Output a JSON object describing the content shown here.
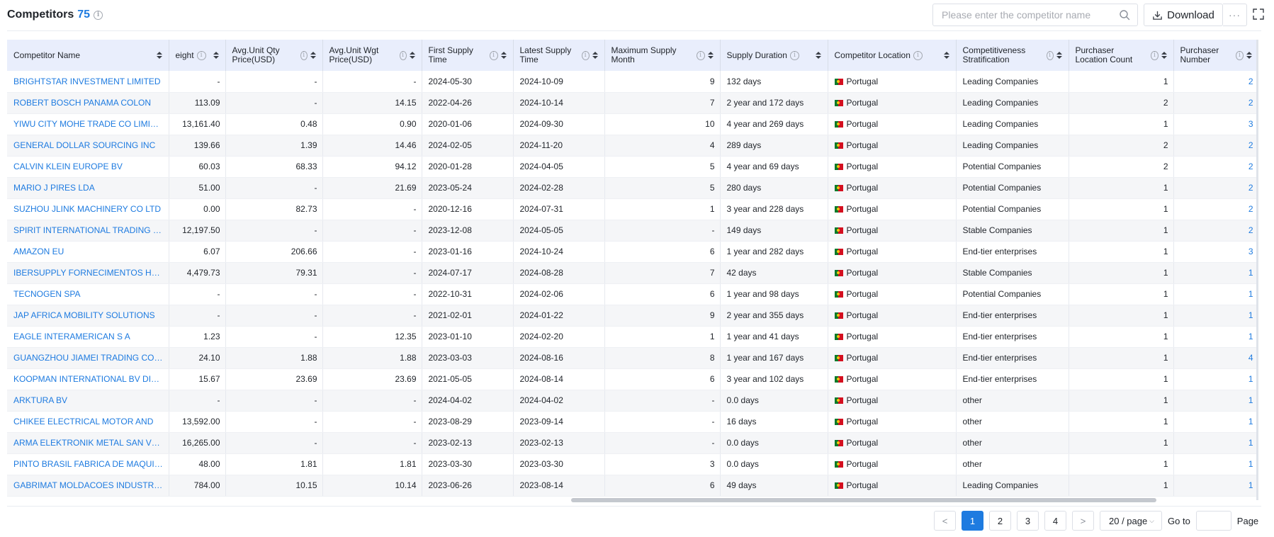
{
  "header": {
    "title": "Competitors",
    "count": "75",
    "search_placeholder": "Please enter the competitor name",
    "download_label": "Download",
    "more_label": "···"
  },
  "table": {
    "columns": [
      {
        "label": "Competitor Name",
        "info": false
      },
      {
        "label": "eight",
        "info": true
      },
      {
        "label": "Avg.Unit Qty Price(USD)",
        "info": true
      },
      {
        "label": "Avg.Unit Wgt Price(USD)",
        "info": true
      },
      {
        "label": "First Supply Time",
        "info": true
      },
      {
        "label": "Latest Supply Time",
        "info": true
      },
      {
        "label": "Maximum Supply Month",
        "info": true
      },
      {
        "label": "Supply Duration",
        "info": true
      },
      {
        "label": "Competitor Location",
        "info": true
      },
      {
        "label": "Competitiveness Stratification",
        "info": true
      },
      {
        "label": "Purchaser Location Count",
        "info": true
      },
      {
        "label": "Purchaser Number",
        "info": true
      }
    ],
    "rows": [
      [
        "BRIGHTSTAR INVESTMENT LIMITED",
        "-",
        "-",
        "-",
        "2024-05-30",
        "2024-10-09",
        "9",
        "132 days",
        "Portugal",
        "Leading Companies",
        "1",
        "2"
      ],
      [
        "ROBERT BOSCH PANAMA COLON",
        "113.09",
        "-",
        "14.15",
        "2022-04-26",
        "2024-10-14",
        "7",
        "2 year and 172 days",
        "Portugal",
        "Leading Companies",
        "2",
        "2"
      ],
      [
        "YIWU CITY MOHE TRADE CO LIMITED",
        "13,161.40",
        "0.48",
        "0.90",
        "2020-01-06",
        "2024-09-30",
        "10",
        "4 year and 269 days",
        "Portugal",
        "Leading Companies",
        "1",
        "3"
      ],
      [
        "GENERAL DOLLAR SOURCING INC",
        "139.66",
        "1.39",
        "14.46",
        "2024-02-05",
        "2024-11-20",
        "4",
        "289 days",
        "Portugal",
        "Leading Companies",
        "2",
        "2"
      ],
      [
        "CALVIN KLEIN EUROPE BV",
        "60.03",
        "68.33",
        "94.12",
        "2020-01-28",
        "2024-04-05",
        "5",
        "4 year and 69 days",
        "Portugal",
        "Potential Companies",
        "2",
        "2"
      ],
      [
        "MARIO J PIRES LDA",
        "51.00",
        "-",
        "21.69",
        "2023-05-24",
        "2024-02-28",
        "5",
        "280 days",
        "Portugal",
        "Potential Companies",
        "1",
        "2"
      ],
      [
        "SUZHOU JLINK MACHINERY CO LTD",
        "0.00",
        "82.73",
        "-",
        "2020-12-16",
        "2024-07-31",
        "1",
        "3 year and 228 days",
        "Portugal",
        "Potential Companies",
        "1",
        "2"
      ],
      [
        "SPIRIT INTERNATIONAL TRADING LTD",
        "12,197.50",
        "-",
        "-",
        "2023-12-08",
        "2024-05-05",
        "-",
        "149 days",
        "Portugal",
        "Stable Companies",
        "1",
        "2"
      ],
      [
        "AMAZON EU",
        "6.07",
        "206.66",
        "-",
        "2023-01-16",
        "2024-10-24",
        "6",
        "1 year and 282 days",
        "Portugal",
        "End-tier enterprises",
        "1",
        "3"
      ],
      [
        "IBERSUPPLY FORNECIMENTOS HOTE...",
        "4,479.73",
        "79.31",
        "-",
        "2024-07-17",
        "2024-08-28",
        "7",
        "42 days",
        "Portugal",
        "Stable Companies",
        "1",
        "1"
      ],
      [
        "TECNOGEN SPA",
        "-",
        "-",
        "-",
        "2022-10-31",
        "2024-02-06",
        "6",
        "1 year and 98 days",
        "Portugal",
        "Potential Companies",
        "1",
        "1"
      ],
      [
        "JAP AFRICA MOBILITY SOLUTIONS",
        "-",
        "-",
        "-",
        "2021-02-01",
        "2024-01-22",
        "9",
        "2 year and 355 days",
        "Portugal",
        "End-tier enterprises",
        "1",
        "1"
      ],
      [
        "EAGLE INTERAMERICAN S A",
        "1.23",
        "-",
        "12.35",
        "2023-01-10",
        "2024-02-20",
        "1",
        "1 year and 41 days",
        "Portugal",
        "End-tier enterprises",
        "1",
        "1"
      ],
      [
        "GUANGZHOU JIAMEI TRADING CO LTD",
        "24.10",
        "1.88",
        "1.88",
        "2023-03-03",
        "2024-08-16",
        "8",
        "1 year and 167 days",
        "Portugal",
        "End-tier enterprises",
        "1",
        "4"
      ],
      [
        "KOOPMAN INTERNATIONAL BV DIST...",
        "15.67",
        "23.69",
        "23.69",
        "2021-05-05",
        "2024-08-14",
        "6",
        "3 year and 102 days",
        "Portugal",
        "End-tier enterprises",
        "1",
        "1"
      ],
      [
        "ARKTURA BV",
        "-",
        "-",
        "-",
        "2024-04-02",
        "2024-04-02",
        "-",
        "0.0 days",
        "Portugal",
        "other",
        "1",
        "1"
      ],
      [
        "CHIKEE ELECTRICAL MOTOR AND",
        "13,592.00",
        "-",
        "-",
        "2023-08-29",
        "2023-09-14",
        "-",
        "16 days",
        "Portugal",
        "other",
        "1",
        "1"
      ],
      [
        "ARMA ELEKTRONIK METAL SAN VE TIC",
        "16,265.00",
        "-",
        "-",
        "2023-02-13",
        "2023-02-13",
        "-",
        "0.0 days",
        "Portugal",
        "other",
        "1",
        "1"
      ],
      [
        "PINTO BRASIL FABRICA DE MAQUINA...",
        "48.00",
        "1.81",
        "1.81",
        "2023-03-30",
        "2023-03-30",
        "3",
        "0.0 days",
        "Portugal",
        "other",
        "1",
        "1"
      ],
      [
        "GABRIMAT MOLDACOES INDUSTRIAI...",
        "784.00",
        "10.15",
        "10.14",
        "2023-06-26",
        "2023-08-14",
        "6",
        "49 days",
        "Portugal",
        "Leading Companies",
        "1",
        "1"
      ]
    ]
  },
  "pagination": {
    "prev": "<",
    "next": ">",
    "pages": [
      "1",
      "2",
      "3",
      "4"
    ],
    "current": "1",
    "page_size": "20 / page",
    "goto_label": "Go to",
    "page_label": "Page"
  },
  "colors": {
    "accent": "#1e7be0",
    "header_bg": "#e9eefc"
  }
}
